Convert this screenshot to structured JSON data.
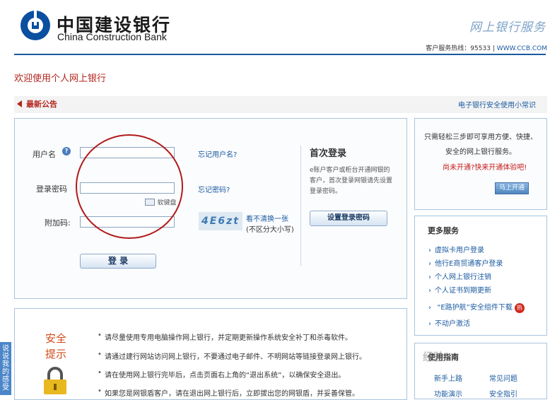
{
  "header": {
    "bank_name_cn": "中国建设银行",
    "bank_name_en": "China Construction Bank",
    "ebank_title": "网上银行服务",
    "hotline_label": "客户服务热线：95533",
    "hotline_sep": "|",
    "site_url": "WWW.CCB.COM"
  },
  "page": {
    "welcome": "欢迎使用个人网上银行"
  },
  "notice": {
    "title": "最新公告",
    "safety_link": "电子银行安全使用小常识"
  },
  "login": {
    "username_label": "用户名",
    "help_icon": "?",
    "password_label": "登录密码",
    "captcha_label": "附加码:",
    "forgot_username": "忘记用户名?",
    "forgot_password": "忘记密码?",
    "soft_keyboard": "软键盘",
    "captcha_text": "4E6zt",
    "captcha_refresh": "看不清换一张",
    "captcha_case": "(不区分大小写)",
    "login_button": "登 录",
    "username_value": "",
    "password_value": "",
    "captcha_value": ""
  },
  "first_login": {
    "title": "首次登录",
    "desc": "e账户客户或柜台开通网银的客户，首次登录网银请先设置登录密码。",
    "button": "设置登录密码"
  },
  "security": {
    "title_line1": "安全",
    "title_line2": "提示",
    "tips": [
      "请尽量使用专用电脑操作网上银行，并定期更新操作系统安全补丁和杀毒软件。",
      "请通过建行网站访问网上银行，不要通过电子邮件、不明网站等链接登录网上银行。",
      "请在使用网上银行完毕后，点击页面右上角的“退出系统”，以确保安全退出。",
      "如果您是网银盾客户，请在退出网上银行后，立即拔出您的网银盾，并妥善保管。"
    ]
  },
  "signup": {
    "desc": "只需轻松三步即可享用方便、快捷、安全的网上银行服务。",
    "red_text": "尚未开通?快来开通体验吧!",
    "button": "马上开通"
  },
  "more_services": {
    "title": "更多服务",
    "items": [
      "虚拟卡用户登录",
      "他行E商贸通客户登录",
      "个人网上银行注销",
      "个人证书到期更新",
      "“E路护航”安全组件下载",
      "不动户激活"
    ],
    "hot_badge": "热"
  },
  "guide": {
    "title": "使用指南",
    "items": [
      "新手上路",
      "常见问题",
      "功能演示",
      "安全指引"
    ]
  },
  "side_tab": "说说我的感受",
  "watermark": "经验"
}
